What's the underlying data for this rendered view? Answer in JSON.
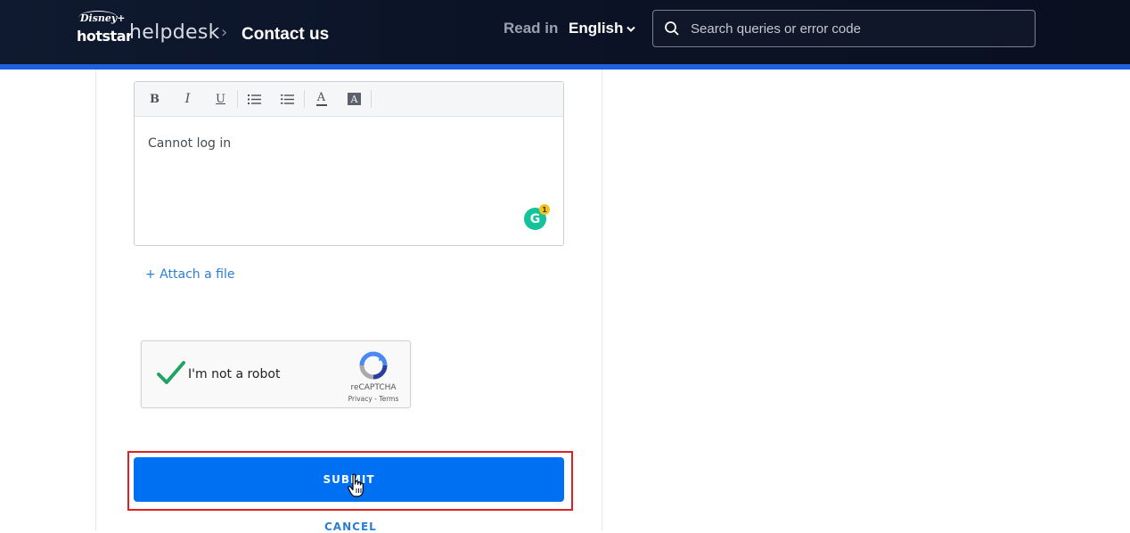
{
  "header": {
    "logo": {
      "line1": "Disney+",
      "line2": "hotstar"
    },
    "brand": "helpdesk",
    "breadcrumb_separator": "›",
    "breadcrumb_current": "Contact us",
    "read_in_label": "Read in",
    "language": "English",
    "search": {
      "placeholder": "Search queries or error code",
      "value": ""
    },
    "colors": {
      "background": "#0b1326",
      "accent_bar": "#1f5fe0"
    }
  },
  "form": {
    "editor": {
      "toolbar": [
        {
          "name": "bold",
          "glyph": "B"
        },
        {
          "name": "italic",
          "glyph": "I"
        },
        {
          "name": "underline",
          "glyph": "U"
        },
        {
          "name": "bulleted-list",
          "glyph": "bulleted-list-icon"
        },
        {
          "name": "numbered-list",
          "glyph": "numbered-list-icon"
        },
        {
          "name": "font-color",
          "glyph": "A"
        },
        {
          "name": "background-color",
          "glyph": "A"
        }
      ],
      "content": "Cannot log in",
      "grammarly": {
        "letter": "G",
        "count": "1"
      }
    },
    "attach_label": "+ Attach a file",
    "captcha": {
      "label": "I'm not a robot",
      "brand": "reCAPTCHA",
      "links": "Privacy - Terms",
      "checked": true
    },
    "submit_label": "SUBMIT",
    "cancel_label": "CANCEL",
    "colors": {
      "primary": "#0070f3",
      "link": "#2a7fd4",
      "highlight": "#e02020"
    }
  }
}
